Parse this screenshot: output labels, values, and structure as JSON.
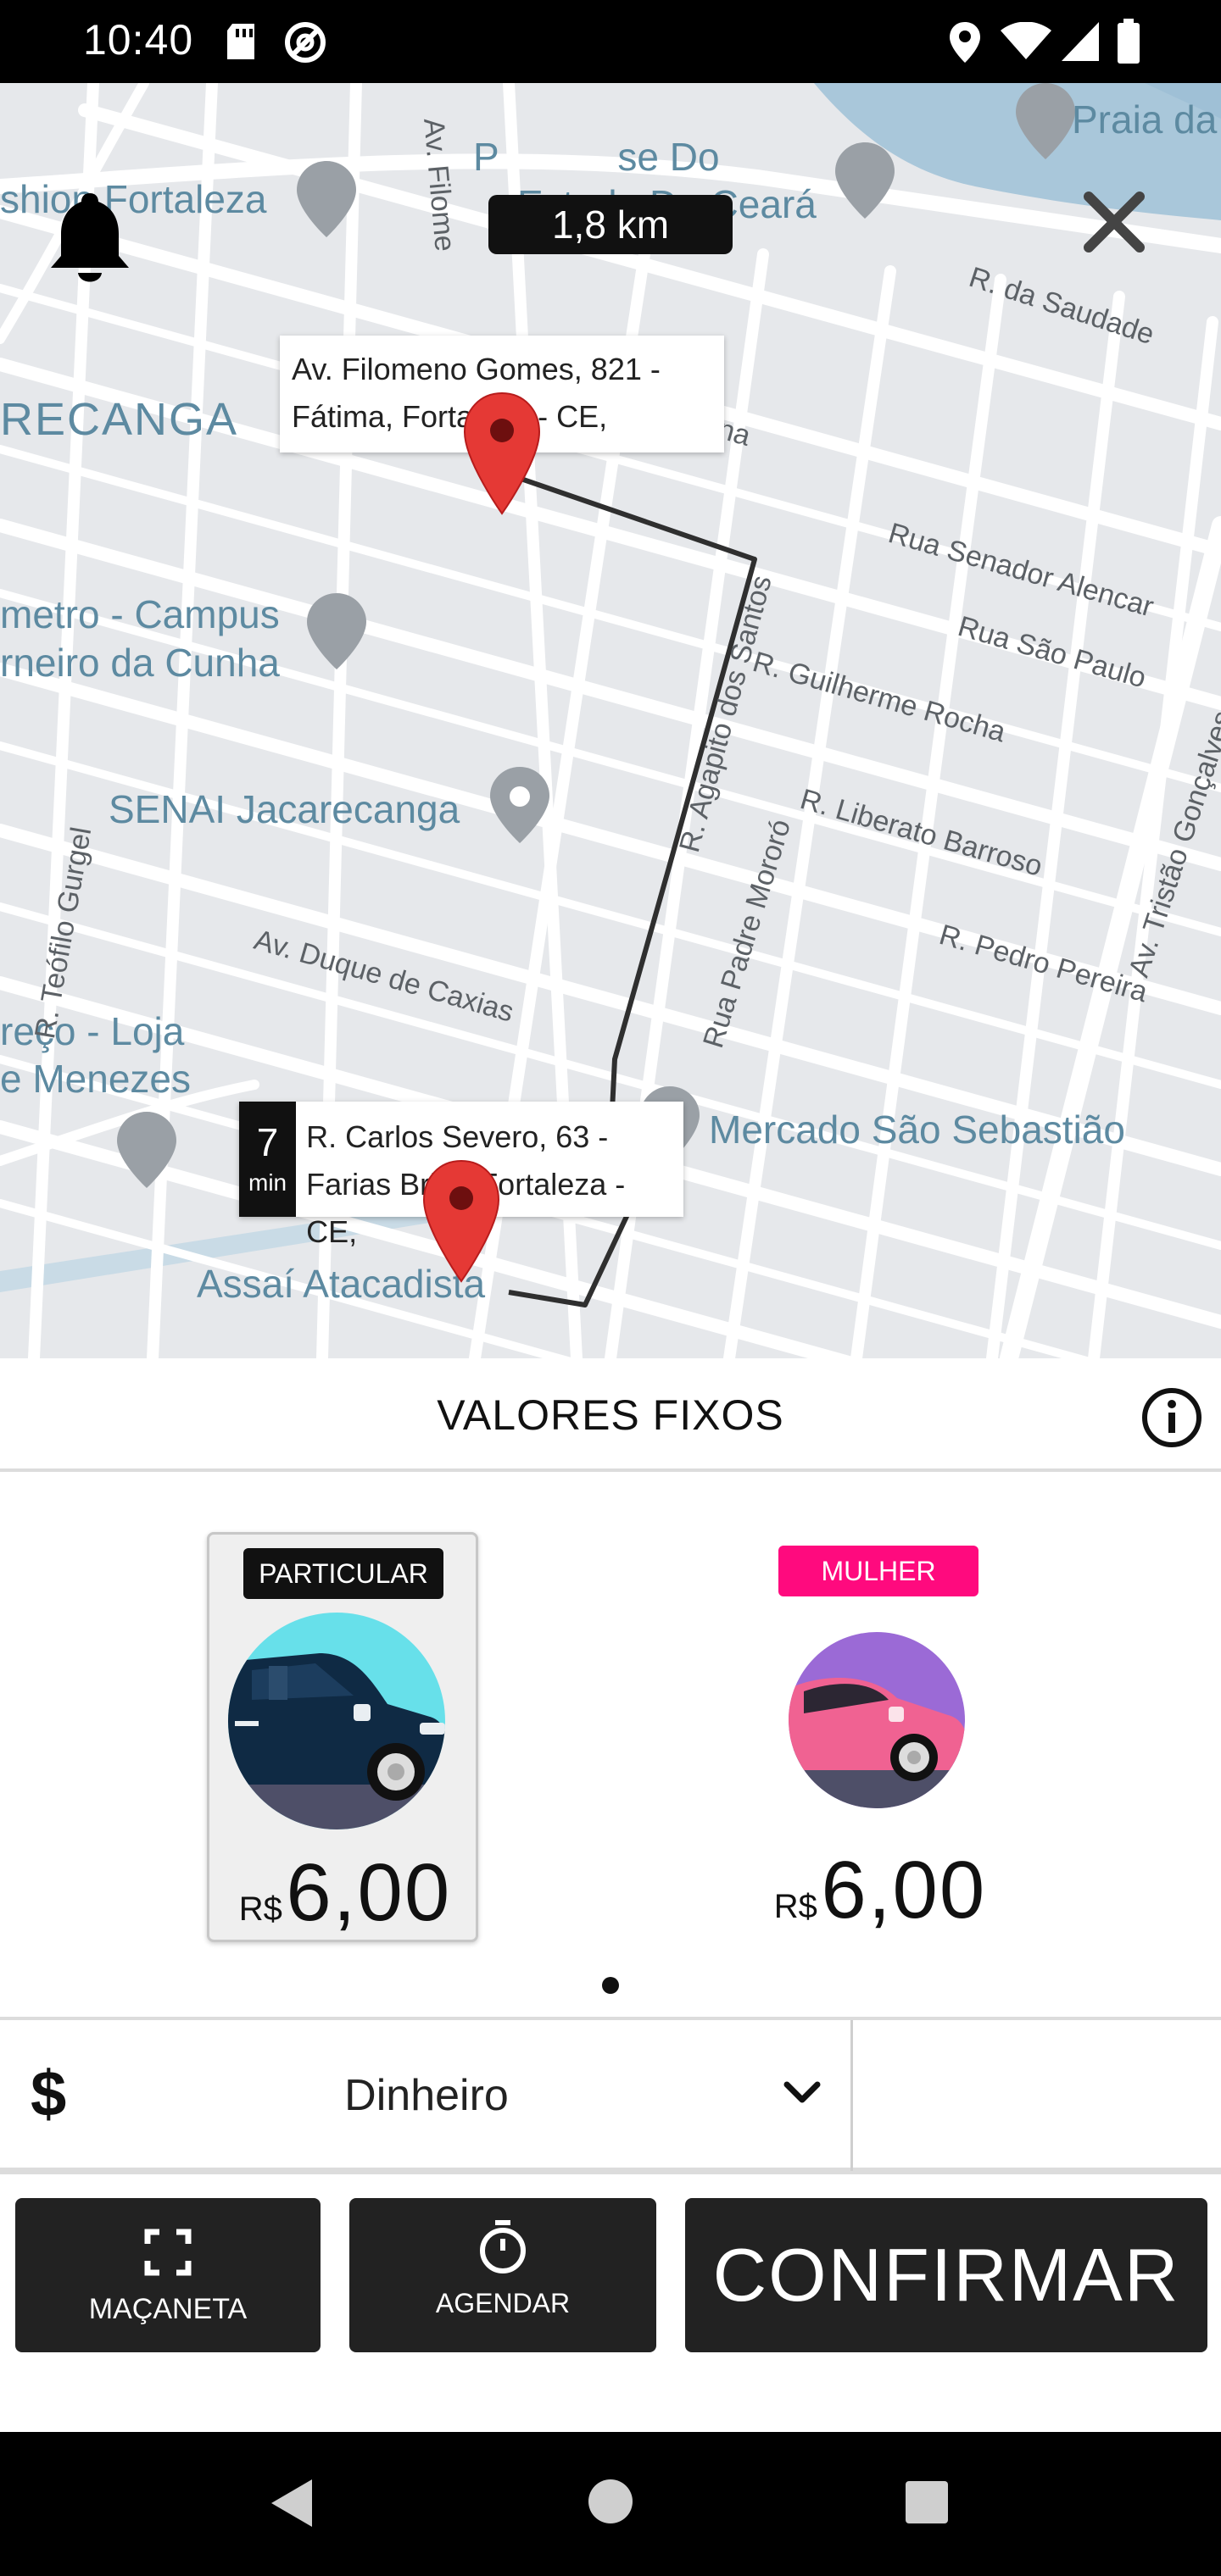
{
  "status_bar": {
    "time": "10:40",
    "icons": [
      "sd-card-icon",
      "at-sign-icon",
      "location-icon",
      "wifi-icon",
      "signal-icon",
      "battery-icon"
    ]
  },
  "map": {
    "distance": "1,8 km",
    "origin_address": "Av. Filomeno Gomes, 821 - Fátima, Fortaleza - CE,",
    "destination_address": "R. Carlos Severo, 63 - Farias Brito, Fortaleza - CE,",
    "eta_value": "7",
    "eta_unit": "min",
    "places": {
      "fortaleza_shop": "shion Fortaleza",
      "estado": "Estado Do Ceará",
      "casa": "P           se Do",
      "praia": "Praia da",
      "jacarecanga": "RECANGA",
      "campus_1": "metro - Campus",
      "campus_2": "rneiro da Cunha",
      "senai": "SENAI Jacarecanga",
      "loja_1": "reço - Loja",
      "loja_2": "e Menezes",
      "mercado": "Mercado São Sebastião",
      "assai": "Assaí Atacadista"
    },
    "streets": {
      "filomeno": "Av. Filome",
      "saudade": "R. da Saudade",
      "tijubana": "R. Tijubana",
      "senador": "Rua Senador Alencar",
      "sao_paulo": "Rua São Paulo",
      "guilherme": "R. Guilherme Rocha",
      "agapito": "R. Agapito dos Santos",
      "liberato": "R. Liberato Barroso",
      "tristao": "Av. Tristão Gonçalves",
      "teofilo": "R. Teófilo Gurgel",
      "duque": "Av. Duque de Caxias",
      "padre": "Rua Padre Mororó",
      "pedro": "R. Pedro Pereira"
    }
  },
  "fixed_values": {
    "title": "VALORES FIXOS"
  },
  "categories": [
    {
      "badge": "PARTICULAR",
      "badge_color": "#111111",
      "currency": "R$",
      "price": "6,00",
      "selected": true
    },
    {
      "badge": "MULHER",
      "badge_color": "#ff0a7e",
      "currency": "R$",
      "price": "6,00",
      "selected": false
    }
  ],
  "payment": {
    "symbol": "$",
    "method": "Dinheiro"
  },
  "actions": {
    "macaneta": "MAÇANETA",
    "agendar": "AGENDAR",
    "confirmar": "CONFIRMAR"
  },
  "colors": {
    "pin_red": "#e53935",
    "dark": "#222222",
    "water": "#a9c7da",
    "pink": "#ff0a7e"
  }
}
